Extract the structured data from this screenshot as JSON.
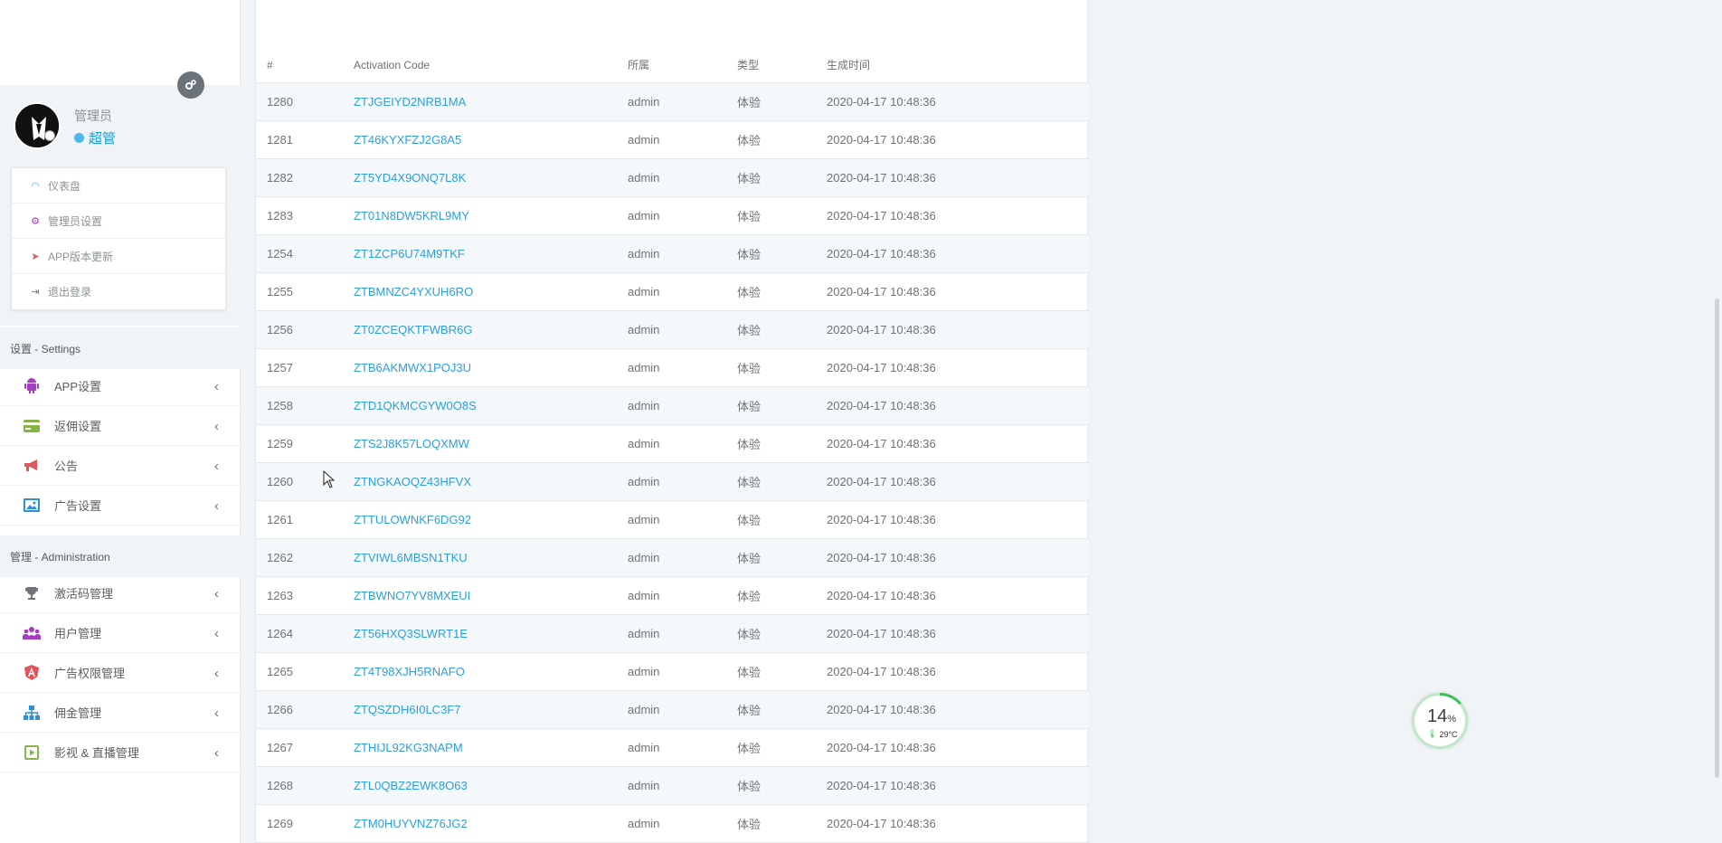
{
  "profile": {
    "role_title": "管理员",
    "role_sub": "超管"
  },
  "quick_menu": [
    {
      "label": "仪表盘",
      "icon": "dashboard-icon"
    },
    {
      "label": "管理员设置",
      "icon": "cogs-icon"
    },
    {
      "label": "APP版本更新",
      "icon": "paper-plane-icon"
    },
    {
      "label": "退出登录",
      "icon": "sign-out-icon"
    }
  ],
  "sections": {
    "settings": "设置 - Settings",
    "admin": "管理 - Administration"
  },
  "nav_settings": [
    {
      "label": "APP设置",
      "icon": "android-icon",
      "color": "#a43ec1"
    },
    {
      "label": "返佣设置",
      "icon": "credit-card-icon",
      "color": "#86b34a"
    },
    {
      "label": "公告",
      "icon": "bullhorn-icon",
      "color": "#e0565a"
    },
    {
      "label": "广告设置",
      "icon": "image-icon",
      "color": "#2d8fd6"
    }
  ],
  "nav_admin": [
    {
      "label": "激活码管理",
      "icon": "trophy-icon",
      "color": "#6f7377"
    },
    {
      "label": "用户管理",
      "icon": "users-icon",
      "color": "#a43ec1"
    },
    {
      "label": "广告权限管理",
      "icon": "angular-icon",
      "color": "#e0565a"
    },
    {
      "label": "佣金管理",
      "icon": "sitemap-icon",
      "color": "#2d8fd6"
    },
    {
      "label": "影视 & 直播管理",
      "icon": "play-square-icon",
      "color": "#86b34a"
    }
  ],
  "table": {
    "headers": [
      "#",
      "Activation Code",
      "所属",
      "类型",
      "生成时间"
    ],
    "rows": [
      [
        "1280",
        "ZTJGEIYD2NRB1MA",
        "admin",
        "体验",
        "2020-04-17 10:48:36"
      ],
      [
        "1281",
        "ZT46KYXFZJ2G8A5",
        "admin",
        "体验",
        "2020-04-17 10:48:36"
      ],
      [
        "1282",
        "ZT5YD4X9ONQ7L8K",
        "admin",
        "体验",
        "2020-04-17 10:48:36"
      ],
      [
        "1283",
        "ZT01N8DW5KRL9MY",
        "admin",
        "体验",
        "2020-04-17 10:48:36"
      ],
      [
        "1254",
        "ZT1ZCP6U74M9TKF",
        "admin",
        "体验",
        "2020-04-17 10:48:36"
      ],
      [
        "1255",
        "ZTBMNZC4YXUH6RO",
        "admin",
        "体验",
        "2020-04-17 10:48:36"
      ],
      [
        "1256",
        "ZT0ZCEQKTFWBR6G",
        "admin",
        "体验",
        "2020-04-17 10:48:36"
      ],
      [
        "1257",
        "ZTB6AKMWX1POJ3U",
        "admin",
        "体验",
        "2020-04-17 10:48:36"
      ],
      [
        "1258",
        "ZTD1QKMCGYW0O8S",
        "admin",
        "体验",
        "2020-04-17 10:48:36"
      ],
      [
        "1259",
        "ZTS2J8K57LOQXMW",
        "admin",
        "体验",
        "2020-04-17 10:48:36"
      ],
      [
        "1260",
        "ZTNGKAOQZ43HFVX",
        "admin",
        "体验",
        "2020-04-17 10:48:36"
      ],
      [
        "1261",
        "ZTTULOWNKF6DG92",
        "admin",
        "体验",
        "2020-04-17 10:48:36"
      ],
      [
        "1262",
        "ZTVIWL6MBSN1TKU",
        "admin",
        "体验",
        "2020-04-17 10:48:36"
      ],
      [
        "1263",
        "ZTBWNO7YV8MXEUI",
        "admin",
        "体验",
        "2020-04-17 10:48:36"
      ],
      [
        "1264",
        "ZT56HXQ3SLWRT1E",
        "admin",
        "体验",
        "2020-04-17 10:48:36"
      ],
      [
        "1265",
        "ZT4T98XJH5RNAFO",
        "admin",
        "体验",
        "2020-04-17 10:48:36"
      ],
      [
        "1266",
        "ZTQSZDH6I0LC3F7",
        "admin",
        "体验",
        "2020-04-17 10:48:36"
      ],
      [
        "1267",
        "ZTHIJL92KG3NAPM",
        "admin",
        "体验",
        "2020-04-17 10:48:36"
      ],
      [
        "1268",
        "ZTL0QBZ2EWK8O63",
        "admin",
        "体验",
        "2020-04-17 10:48:36"
      ],
      [
        "1269",
        "ZTM0HUYVNZ76JG2",
        "admin",
        "体验",
        "2020-04-17 10:48:36"
      ]
    ]
  },
  "cpu_widget": {
    "percent": "14",
    "percent_unit": "%",
    "temperature": "29°C",
    "accent": "#3cc15a"
  }
}
